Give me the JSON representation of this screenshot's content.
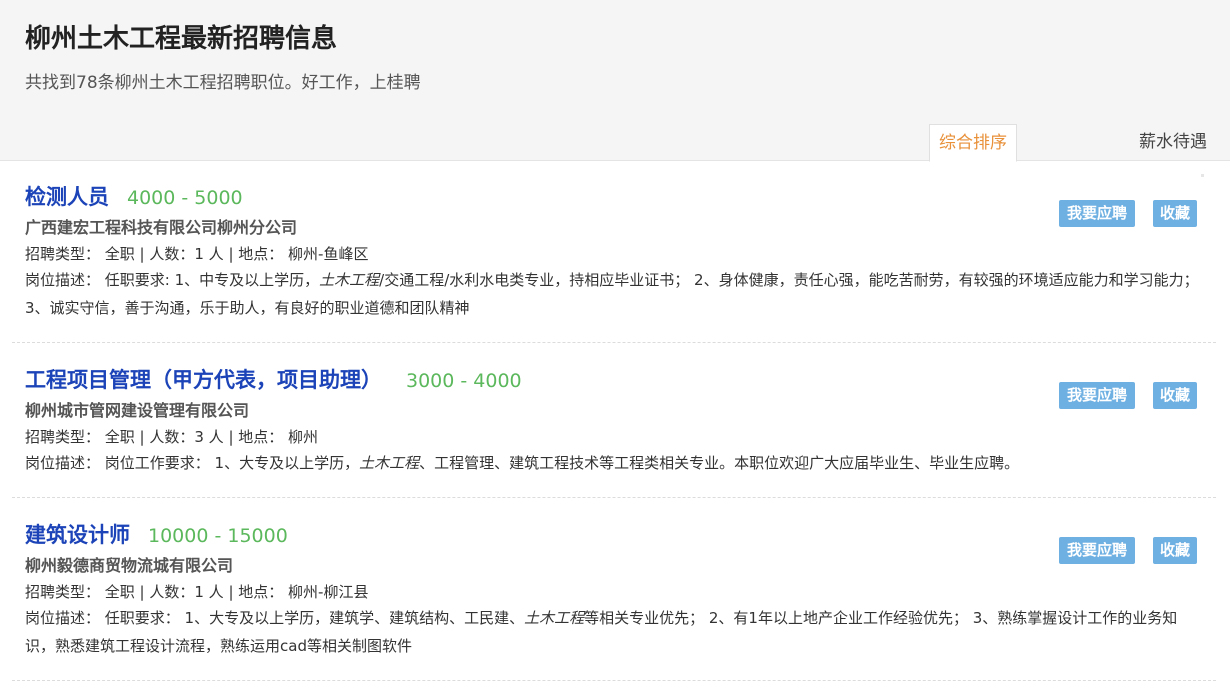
{
  "header": {
    "title": "柳州土木工程最新招聘信息",
    "subtitle": "共找到78条柳州土木工程招聘职位。好工作，上桂聘"
  },
  "tabs": [
    {
      "label": "综合排序",
      "active": true
    },
    {
      "label": "薪水待遇",
      "active": false
    }
  ],
  "buttons": {
    "apply": "我要应聘",
    "favorite": "收藏"
  },
  "jobs": [
    {
      "title": "检测人员",
      "salary": "4000 - 5000",
      "company": "广西建宏工程科技有限公司柳州分公司",
      "meta": "招聘类型：  全职 | 人数：1 人 | 地点：  柳州-鱼峰区",
      "desc_pre": "岗位描述：  任职要求: 1、中专及以上学历，",
      "desc_em": "土木工程",
      "desc_post": "/交通工程/水利水电类专业，持相应毕业证书；  2、身体健康，责任心强，能吃苦耐劳，有较强的环境适应能力和学习能力；  3、诚实守信，善于沟通，乐于助人，有良好的职业道德和团队精神"
    },
    {
      "title": "工程项目管理（甲方代表，项目助理）",
      "salary": "3000 - 4000",
      "company": "柳州城市管网建设管理有限公司",
      "meta": "招聘类型：  全职 | 人数：3 人 | 地点：  柳州",
      "desc_pre": "岗位描述：  岗位工作要求：  1、大专及以上学历，",
      "desc_em": "土木工程",
      "desc_post": "、工程管理、建筑工程技术等工程类相关专业。本职位欢迎广大应届毕业生、毕业生应聘。"
    },
    {
      "title": "建筑设计师",
      "salary": "10000 - 15000",
      "company": "柳州毅德商贸物流城有限公司",
      "meta": "招聘类型：  全职 | 人数：1 人 | 地点：  柳州-柳江县",
      "desc_pre": "岗位描述：  任职要求：  1、大专及以上学历，建筑学、建筑结构、工民建、",
      "desc_em": "土木工程",
      "desc_post": "等相关专业优先；  2、有1年以上地产企业工作经验优先；  3、熟练掌握设计工作的业务知识，熟悉建筑工程设计流程，熟练运用cad等相关制图软件"
    }
  ]
}
